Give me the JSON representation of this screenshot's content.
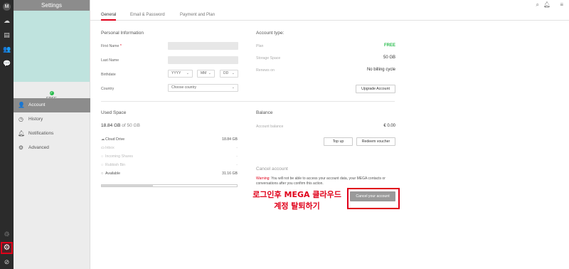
{
  "sidepanel": {
    "title": "Settings",
    "plan_badge": "FREE",
    "menu": [
      {
        "label": "Account",
        "icon": "user-icon"
      },
      {
        "label": "History",
        "icon": "clock-icon"
      },
      {
        "label": "Notifications",
        "icon": "bell-icon"
      },
      {
        "label": "Advanced",
        "icon": "cogs-icon"
      }
    ]
  },
  "tabs": [
    "General",
    "Email & Password",
    "Payment and Plan"
  ],
  "personal": {
    "title": "Personal Information",
    "first_name_label": "First Name",
    "required_mark": "*",
    "last_name_label": "Last Name",
    "birthdate_label": "Birthdate",
    "year_placeholder": "YYYY",
    "month_placeholder": "MM",
    "day_placeholder": "DD",
    "country_label": "Country",
    "country_placeholder": "Choose country"
  },
  "account_type": {
    "title": "Account type:",
    "plan_label": "Plan",
    "plan_value": "FREE",
    "storage_label": "Storage Space",
    "storage_value": "50 GB",
    "renews_label": "Renews on",
    "renews_value": "No billing cycle",
    "upgrade_button": "Upgrade Account"
  },
  "used_space": {
    "title": "Used Space",
    "summary_used": "18.84 GB",
    "summary_of": "of",
    "summary_total": "50 GB",
    "rows": [
      {
        "label": "Cloud Drive",
        "value": "18.84 GB"
      },
      {
        "label": "Inbox",
        "value": "-"
      },
      {
        "label": "Incoming Shares",
        "value": "-"
      },
      {
        "label": "Rubbish Bin",
        "value": "-"
      },
      {
        "label": "Available",
        "value": "31.16 GB"
      }
    ],
    "used_fraction": 0.377
  },
  "balance": {
    "title": "Balance",
    "label": "Account balance",
    "value": "€ 0.00",
    "topup_button": "Top up",
    "redeem_button": "Redeem voucher"
  },
  "cancel": {
    "title": "Cancel account",
    "warning_prefix": "Warning:",
    "warning_text": "You will not be able to access your account data, your MEGA contacts or conversations after you confirm this action.",
    "button": "Cancel your account"
  },
  "annotation": {
    "line1": "로그인후 MEGA 클라우드",
    "line2": "계정 탈퇴하기"
  },
  "colors": {
    "accent": "#e0001a",
    "free_green": "#2bbd4f",
    "rail": "#2b2b2b",
    "panel": "#ececec"
  }
}
